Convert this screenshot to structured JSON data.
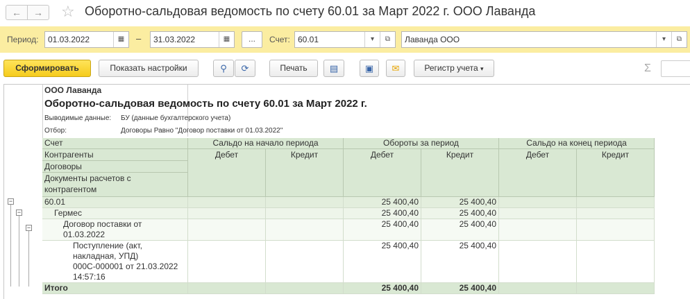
{
  "window": {
    "back_glyph": "←",
    "forward_glyph": "→",
    "star_glyph": "☆",
    "title": "Оборотно-сальдовая ведомость по счету 60.01 за Март 2022 г. ООО Лаванда"
  },
  "params": {
    "period_label": "Период:",
    "date_from": "01.03.2022",
    "dash": "–",
    "date_to": "31.03.2022",
    "dots": "...",
    "account_label": "Счет:",
    "account": "60.01",
    "organization": "Лаванда ООО"
  },
  "toolbar": {
    "generate": "Сформировать",
    "show_settings": "Показать настройки",
    "print": "Печать",
    "register": "Регистр учета",
    "sigma": "Σ"
  },
  "report": {
    "org": "ООО Лаванда",
    "heading": "Оборотно-сальдовая ведомость по счету 60.01 за Март 2022 г.",
    "data_label": "Выводимые данные:",
    "data_value": "БУ (данные бухгалтерского учета)",
    "filter_label": "Отбор:",
    "filter_value": "Договоры Равно \"Договор поставки от 01.03.2022\"",
    "columns": {
      "account": "Счет",
      "counterparties": "Контрагенты",
      "contracts": "Договоры",
      "documents": "Документы расчетов с",
      "documents_2": "контрагентом",
      "opening": "Сальдо на начало периода",
      "turnover": "Обороты за период",
      "closing": "Сальдо на конец периода",
      "debit": "Дебет",
      "credit": "Кредит"
    },
    "rows": {
      "r1_name": "60.01",
      "r1_td": "25 400,40",
      "r1_tc": "25 400,40",
      "r2_name": "Гермес",
      "r2_td": "25 400,40",
      "r2_tc": "25 400,40",
      "r3_name": "Договор поставки от",
      "r3_name2": "01.03.2022",
      "r3_td": "25 400,40",
      "r3_tc": "25 400,40",
      "r4_l1": "Поступление (акт,",
      "r4_l2": "накладная, УПД)",
      "r4_l3": "000С-000001 от 21.03.2022",
      "r4_l4": "14:57:16",
      "r4_td": "25 400,40",
      "r4_tc": "25 400,40",
      "total_name": "Итого",
      "total_td": "25 400,40",
      "total_tc": "25 400,40"
    },
    "tree_glyph": "−"
  }
}
